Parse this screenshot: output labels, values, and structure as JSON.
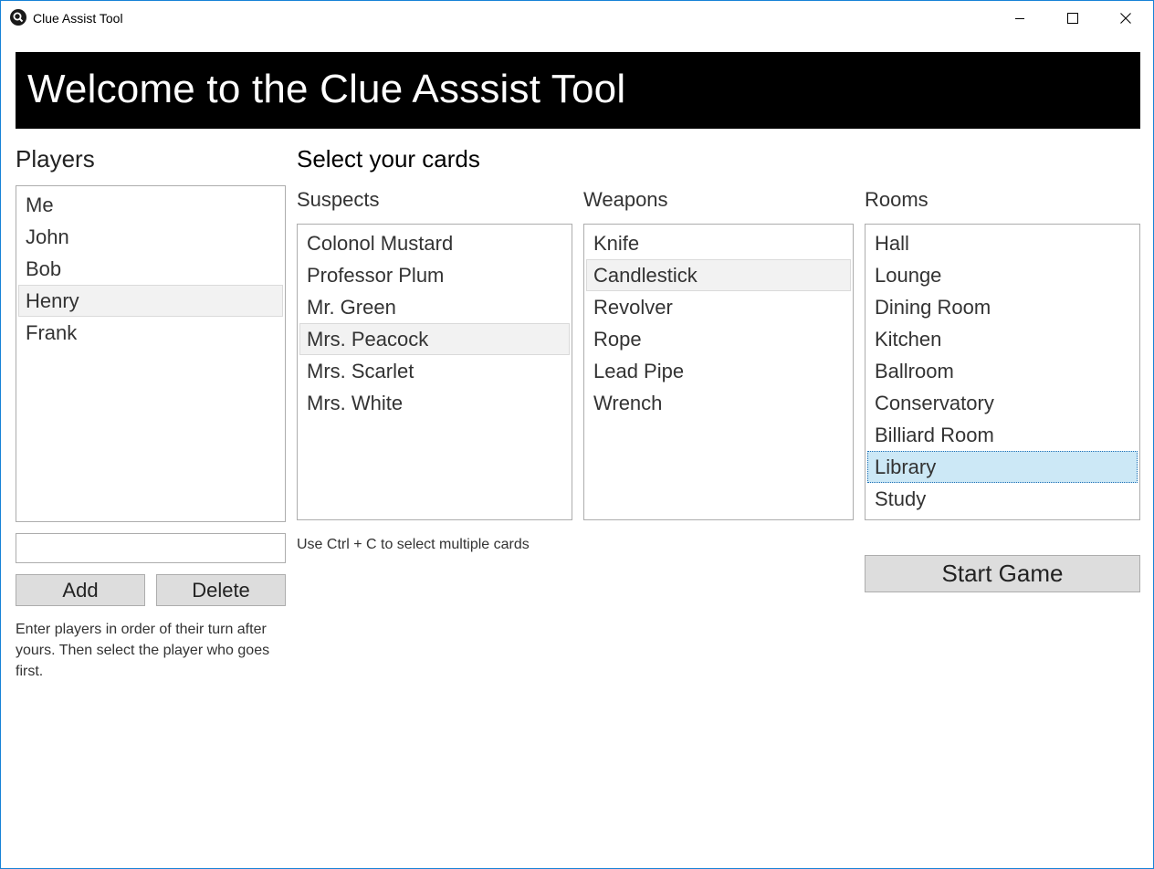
{
  "window": {
    "title": "Clue Assist Tool",
    "icon": "magnifier-icon",
    "controls": [
      "minimize-icon",
      "maximize-icon",
      "close-icon"
    ]
  },
  "banner": {
    "title": "Welcome to the Clue Asssist Tool"
  },
  "players": {
    "label": "Players",
    "items": [
      {
        "label": "Me"
      },
      {
        "label": "John"
      },
      {
        "label": "Bob"
      },
      {
        "label": "Henry"
      },
      {
        "label": "Frank"
      }
    ],
    "input_value": "",
    "add_label": "Add",
    "delete_label": "Delete",
    "hint": "Enter players in order of their turn after yours. Then select the player who goes first."
  },
  "cards": {
    "heading": "Select your cards",
    "hint": "Use Ctrl + C to select multiple cards",
    "suspects": {
      "label": "Suspects",
      "items": [
        {
          "label": "Colonol Mustard"
        },
        {
          "label": "Professor Plum"
        },
        {
          "label": "Mr. Green"
        },
        {
          "label": "Mrs. Peacock"
        },
        {
          "label": "Mrs. Scarlet"
        },
        {
          "label": "Mrs. White"
        }
      ]
    },
    "weapons": {
      "label": "Weapons",
      "items": [
        {
          "label": "Knife"
        },
        {
          "label": "Candlestick"
        },
        {
          "label": "Revolver"
        },
        {
          "label": "Rope"
        },
        {
          "label": "Lead Pipe"
        },
        {
          "label": "Wrench"
        }
      ]
    },
    "rooms": {
      "label": "Rooms",
      "items": [
        {
          "label": "Hall"
        },
        {
          "label": "Lounge"
        },
        {
          "label": "Dining Room"
        },
        {
          "label": "Kitchen"
        },
        {
          "label": "Ballroom"
        },
        {
          "label": "Conservatory"
        },
        {
          "label": "Billiard Room"
        },
        {
          "label": "Library"
        },
        {
          "label": "Study"
        }
      ],
      "selected": "Library"
    }
  },
  "start_label": "Start Game",
  "colors": {
    "banner_bg": "#000000",
    "selection": "#cce8f6",
    "hover": "#f2f2f2",
    "button_bg": "#dddddd"
  }
}
